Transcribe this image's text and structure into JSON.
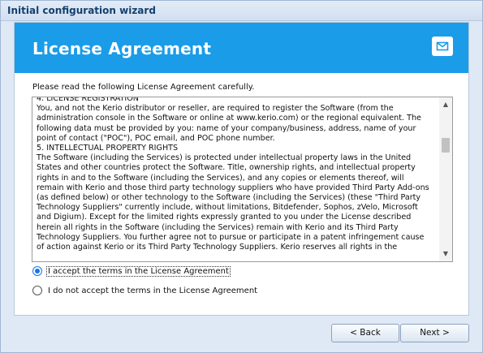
{
  "window": {
    "title": "Initial configuration wizard"
  },
  "header": {
    "title": "License Agreement",
    "icon": "mail-icon",
    "color": "#1a9ce8"
  },
  "intro_text": "Please read the following License Agreement carefully.",
  "license": {
    "lines": [
      "4. LICENSE REGISTRATION",
      "You, and not the Kerio distributor or reseller, are required to register the Software (from the",
      "administration console in the Software or online at www.kerio.com) or the regional equivalent. The",
      "following data must be provided by you: name of your company/business, address, name of your",
      "point of contact (\"POC\"), POC email, and POC phone number.",
      "5. INTELLECTUAL PROPERTY RIGHTS",
      "The Software (including the Services) is protected under intellectual property laws in the United",
      "States and other countries protect the Software. Title, ownership rights, and intellectual property",
      "rights in and to the Software (including the Services), and any copies or elements thereof, will",
      "remain with Kerio and those third party technology suppliers who have provided Third Party Add-ons",
      "(as defined below) or other technology to the Software (including the Services) (these \"Third Party",
      "Technology Suppliers\" currently include, without limitations, Bitdefender, Sophos, zVelo, Microsoft",
      "and Digium). Except for the limited rights expressly granted to you under the License described",
      "herein all rights in the Software (including the Services) remain with Kerio and its Third Party",
      "Technology Suppliers. You further agree not to pursue or participate in a patent infringement cause",
      "of action against Kerio or its Third Party Technology Suppliers. Kerio reserves all rights in the"
    ]
  },
  "options": {
    "accept_label": "I accept the terms in the License Agreement",
    "decline_label": "I do not accept the terms in the License Agreement",
    "selected": "accept"
  },
  "buttons": {
    "back": "< Back",
    "next": "Next >"
  }
}
